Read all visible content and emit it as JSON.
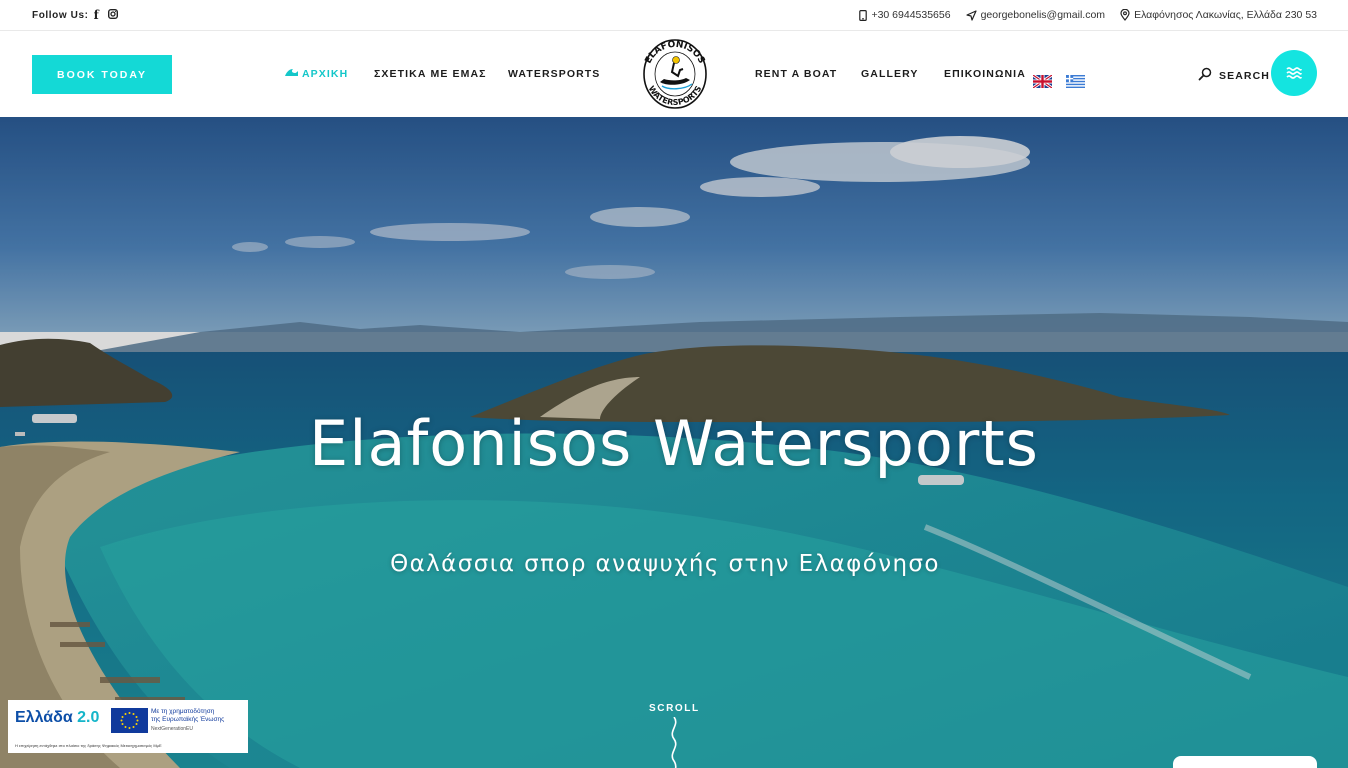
{
  "topbar": {
    "follow_label": "Follow Us:",
    "phone": "+30 6944535656",
    "email": "georgebonelis@gmail.com",
    "address": "Ελαφόνησος Λακωνίας, Ελλάδα 230 53"
  },
  "header": {
    "book_label": "BOOK TODAY",
    "nav": {
      "home": "ΑΡΧΙΚΗ",
      "about": "ΣΧΕΤΙΚΑ ΜΕ ΕΜΑΣ",
      "watersports": "WATERSPORTS",
      "rent": "RENT A BOAT",
      "gallery": "GALLERY",
      "contact": "ΕΠΙΚΟΙΝΩΝΙΑ"
    },
    "logo_top": "ELAFONISOS",
    "logo_bottom": "WATERSPORTS",
    "search_label": "SEARCH",
    "accent": "#14d9d6"
  },
  "hero": {
    "title": "Elafonisos Watersports",
    "subtitle": "Θαλάσσια σπορ αναψυχής στην Ελαφόνησο",
    "scroll_label": "SCROLL"
  },
  "eu_badge": {
    "greece_label": "Ελλάδα",
    "greece_version": "2.0",
    "funding_line1": "Με τη χρηματοδότηση",
    "funding_line2": "της Ευρωπαϊκής Ένωσης",
    "nextgen": "NextGenerationEU",
    "footer": "Η επιχείρηση εντάχθηκε στο πλαίσιο της δράσης Ψηφιακός Μετασχηματισμός ΜμΕ"
  }
}
